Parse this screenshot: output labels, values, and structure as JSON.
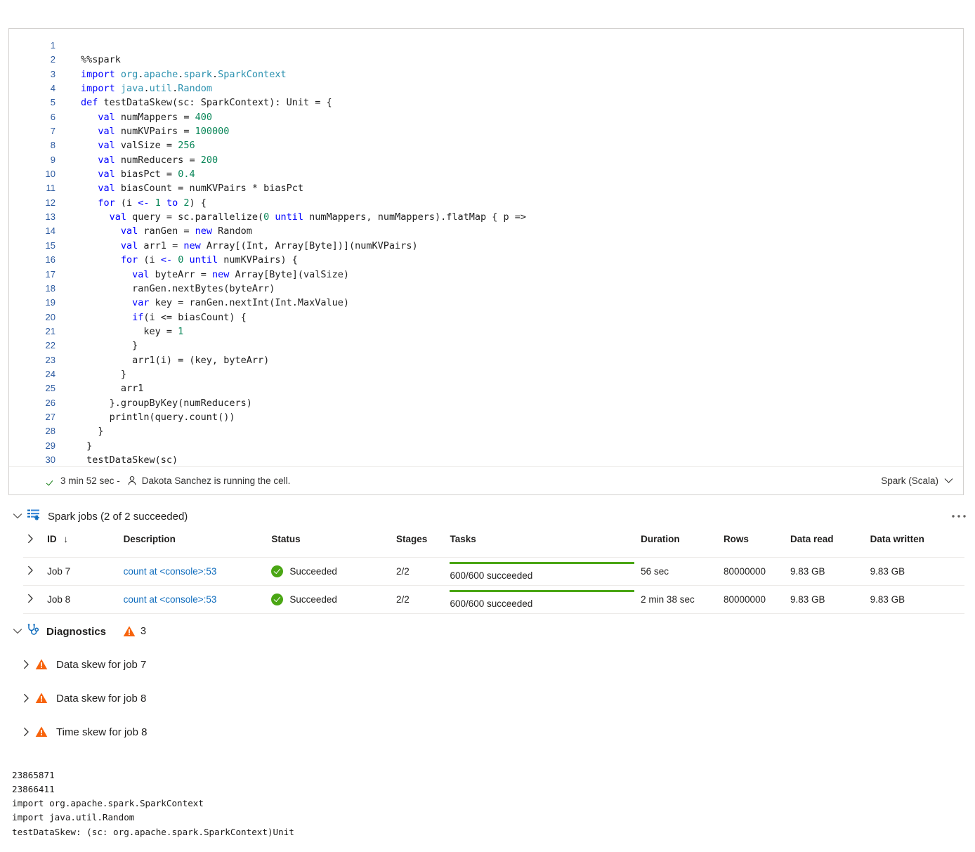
{
  "cell": {
    "language": "Spark (Scala)",
    "status_duration": "3 min 52 sec -",
    "status_user": "Dakota Sanchez is running the cell.",
    "lines": [
      {
        "n": "1",
        "html": ""
      },
      {
        "n": "2",
        "html": "%%spark"
      },
      {
        "n": "3",
        "html": "<span class='kw'>import</span> <span class='typ'>org</span>.<span class='typ'>apache</span>.<span class='typ'>spark</span>.<span class='typ'>SparkContext</span>"
      },
      {
        "n": "4",
        "html": "<span class='kw'>import</span> <span class='typ'>java</span>.<span class='typ'>util</span>.<span class='typ'>Random</span>"
      },
      {
        "n": "5",
        "html": "<span class='kw'>def</span> testDataSkew(sc: SparkContext): Unit = {"
      },
      {
        "n": "6",
        "html": "   <span class='kw'>val</span> numMappers = <span class='num'>400</span>"
      },
      {
        "n": "7",
        "html": "   <span class='kw'>val</span> numKVPairs = <span class='num'>100000</span>"
      },
      {
        "n": "8",
        "html": "   <span class='kw'>val</span> valSize = <span class='num'>256</span>"
      },
      {
        "n": "9",
        "html": "   <span class='kw'>val</span> numReducers = <span class='num'>200</span>"
      },
      {
        "n": "10",
        "html": "   <span class='kw'>val</span> biasPct = <span class='num'>0.4</span>"
      },
      {
        "n": "11",
        "html": "   <span class='kw'>val</span> biasCount = numKVPairs * biasPct"
      },
      {
        "n": "12",
        "html": "   <span class='kw'>for</span> (i <span class='kw'>&lt;-</span> <span class='num'>1</span> <span class='kw'>to</span> <span class='num'>2</span>) {"
      },
      {
        "n": "13",
        "html": "     <span class='kw'>val</span> query = sc.parallelize(<span class='num'>0</span> <span class='kw'>until</span> numMappers, numMappers).flatMap { p =&gt;"
      },
      {
        "n": "14",
        "html": "       <span class='kw'>val</span> ranGen = <span class='kw'>new</span> Random"
      },
      {
        "n": "15",
        "html": "       <span class='kw'>val</span> arr1 = <span class='kw'>new</span> Array[(Int, Array[Byte])](numKVPairs)"
      },
      {
        "n": "16",
        "html": "       <span class='kw'>for</span> (i <span class='kw'>&lt;-</span> <span class='num'>0</span> <span class='kw'>until</span> numKVPairs) {"
      },
      {
        "n": "17",
        "html": "         <span class='kw'>val</span> byteArr = <span class='kw'>new</span> Array[Byte](valSize)"
      },
      {
        "n": "18",
        "html": "         ranGen.nextBytes(byteArr)"
      },
      {
        "n": "19",
        "html": "         <span class='kw'>var</span> key = ranGen.nextInt(Int.MaxValue)"
      },
      {
        "n": "20",
        "html": "         <span class='kw'>if</span>(i &lt;= biasCount) {"
      },
      {
        "n": "21",
        "html": "           key = <span class='num'>1</span>"
      },
      {
        "n": "22",
        "html": "         }"
      },
      {
        "n": "23",
        "html": "         arr1(i) = (key, byteArr)"
      },
      {
        "n": "24",
        "html": "       }"
      },
      {
        "n": "25",
        "html": "       arr1"
      },
      {
        "n": "26",
        "html": "     }.groupByKey(numReducers)"
      },
      {
        "n": "27",
        "html": "     println(query.count())"
      },
      {
        "n": "28",
        "html": "   }"
      },
      {
        "n": "29",
        "html": " }"
      },
      {
        "n": "30",
        "html": " testDataSkew(sc)"
      }
    ]
  },
  "spark_jobs": {
    "title": "Spark jobs (2 of 2 succeeded)",
    "columns": [
      "ID",
      "Description",
      "Status",
      "Stages",
      "Tasks",
      "Duration",
      "Rows",
      "Data read",
      "Data written"
    ],
    "sort_indicator": "↓",
    "rows": [
      {
        "id": "Job 7",
        "description": "count at <console>:53",
        "status": "Succeeded",
        "stages": "2/2",
        "tasks": "600/600 succeeded",
        "tasks_percent": 100,
        "duration": "56 sec",
        "rows": "80000000",
        "data_read": "9.83 GB",
        "data_written": "9.83 GB"
      },
      {
        "id": "Job 8",
        "description": "count at <console>:53",
        "status": "Succeeded",
        "stages": "2/2",
        "tasks": "600/600 succeeded",
        "tasks_percent": 100,
        "duration": "2 min 38 sec",
        "rows": "80000000",
        "data_read": "9.83 GB",
        "data_written": "9.83 GB"
      }
    ]
  },
  "diagnostics": {
    "title": "Diagnostics",
    "count": "3",
    "items": [
      "Data skew for job 7",
      "Data skew for job 8",
      "Time skew for job 8"
    ]
  },
  "console_output": "23865871\n23866411\nimport org.apache.spark.SparkContext\nimport java.util.Random\ntestDataSkew: (sc: org.apache.spark.SparkContext)Unit",
  "colors": {
    "accent_link": "#0f6cbd",
    "success_green": "#4aa614",
    "warning_orange": "#f7630c",
    "icon_blue": "#0f6cbd",
    "border": "#d2d0ce"
  }
}
